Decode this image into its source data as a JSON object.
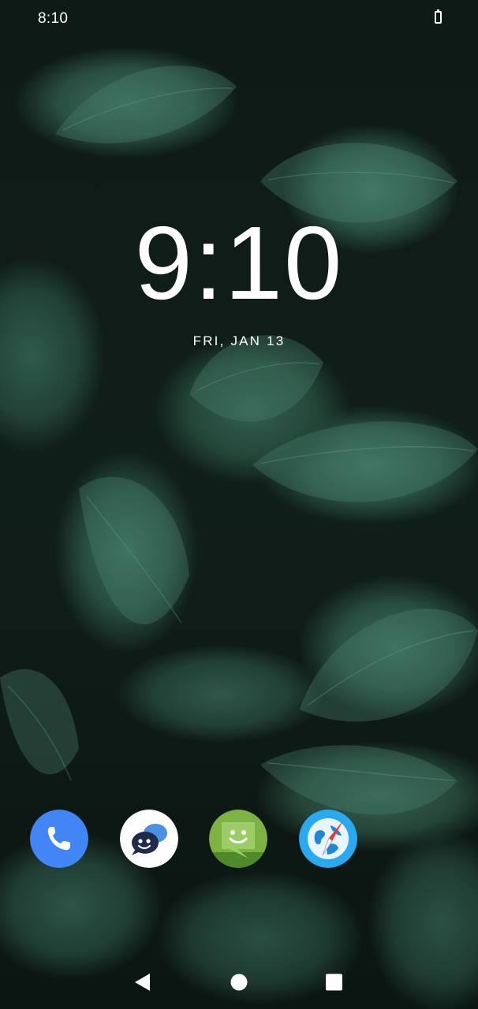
{
  "status_bar": {
    "time": "8:10",
    "battery_icon": "battery-icon"
  },
  "lock_screen": {
    "clock": "9:10",
    "date": "FRI, JAN 13"
  },
  "dock": {
    "apps": [
      {
        "name": "Phone",
        "icon": "phone-icon",
        "color": "#4285f4"
      },
      {
        "name": "Messenger",
        "icon": "chat-bubbles-icon",
        "color": "#ffffff"
      },
      {
        "name": "Messaging",
        "icon": "smiley-message-icon",
        "color": "#7cb342"
      },
      {
        "name": "Browser",
        "icon": "globe-compass-icon",
        "color": "#29a9f0"
      }
    ]
  },
  "navigation": {
    "back": "back-triangle-icon",
    "home": "home-circle-icon",
    "recents": "recents-square-icon"
  },
  "colors": {
    "wallpaper_leaf": "#3b6b5b",
    "wallpaper_dark": "#0e1a16",
    "text": "#ffffff"
  }
}
